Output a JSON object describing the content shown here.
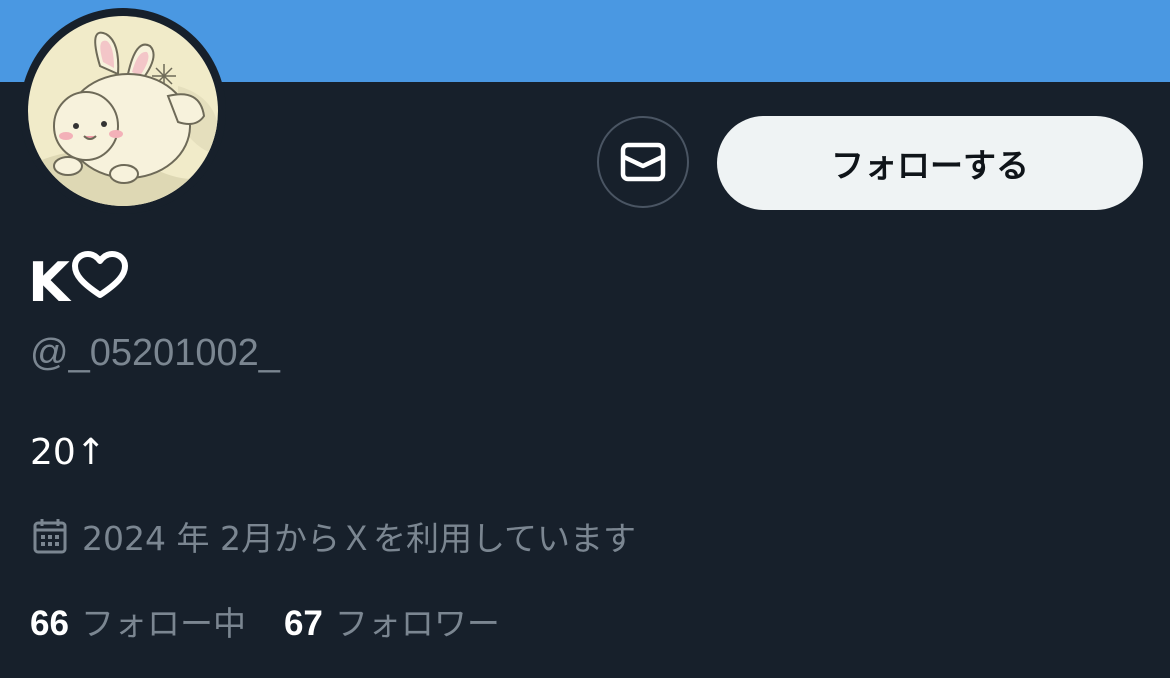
{
  "colors": {
    "banner": "#4a98e2",
    "background": "#17202b",
    "primary_text": "#ffffff",
    "secondary_text": "#7b8691",
    "follow_button_bg": "#eff3f4",
    "follow_button_text": "#0f1419",
    "outline": "#4a5563"
  },
  "profile": {
    "avatar_icon": "bunny-character-avatar",
    "display_name": "K",
    "name_suffix_icon": "white-heart-icon",
    "handle": "@_05201002_",
    "bio": "20↑",
    "joined": "2024 年 2月からＸを利用しています",
    "joined_icon": "calendar-icon"
  },
  "actions": {
    "message_icon": "envelope-icon",
    "follow_label": "フォローする"
  },
  "stats": {
    "following_count": "66",
    "following_label": "フォロー中",
    "followers_count": "67",
    "followers_label": "フォロワー"
  }
}
